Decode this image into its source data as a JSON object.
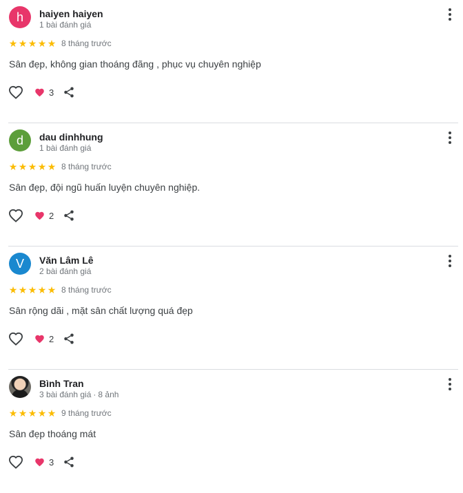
{
  "reviews": [
    {
      "avatar_letter": "h",
      "avatar_color": "#e8366a",
      "avatar_type": "letter",
      "name": "haiyen haiyen",
      "meta": "1 bài đánh giá",
      "photos": "",
      "rating": 5,
      "date": "8 tháng trước",
      "text": "Sân đẹp, không gian thoáng đãng , phục vụ chuyên nghiệp",
      "reactions": "3"
    },
    {
      "avatar_letter": "d",
      "avatar_color": "#5c9e3a",
      "avatar_type": "letter",
      "name": "dau dinhhung",
      "meta": "1 bài đánh giá",
      "photos": "",
      "rating": 5,
      "date": "8 tháng trước",
      "text": "Sân đẹp, đội ngũ huấn luyện chuyên nghiệp.",
      "reactions": "2"
    },
    {
      "avatar_letter": "V",
      "avatar_color": "#1a88cf",
      "avatar_type": "letter",
      "name": "Văn Lâm Lê",
      "meta": "2 bài đánh giá",
      "photos": "",
      "rating": 5,
      "date": "8 tháng trước",
      "text": "Sân rộng dãi , mặt sân chất lượng quá đẹp",
      "reactions": "2"
    },
    {
      "avatar_letter": "",
      "avatar_color": "#6d6a63",
      "avatar_type": "photo",
      "name": "Bình Tran",
      "meta": "3 bài đánh giá",
      "photos": "8 ảnh",
      "rating": 5,
      "date": "9 tháng trước",
      "text": "Sân đẹp thoáng mát",
      "reactions": "3"
    }
  ],
  "icons": {
    "star": "★",
    "like": "heart-outline-icon",
    "reaction": "heart-filled-icon",
    "share": "share-icon",
    "more": "more-vert-icon"
  },
  "colors": {
    "star": "#fbbc04",
    "reaction_heart": "#e8366a",
    "divider": "#dadce0"
  }
}
